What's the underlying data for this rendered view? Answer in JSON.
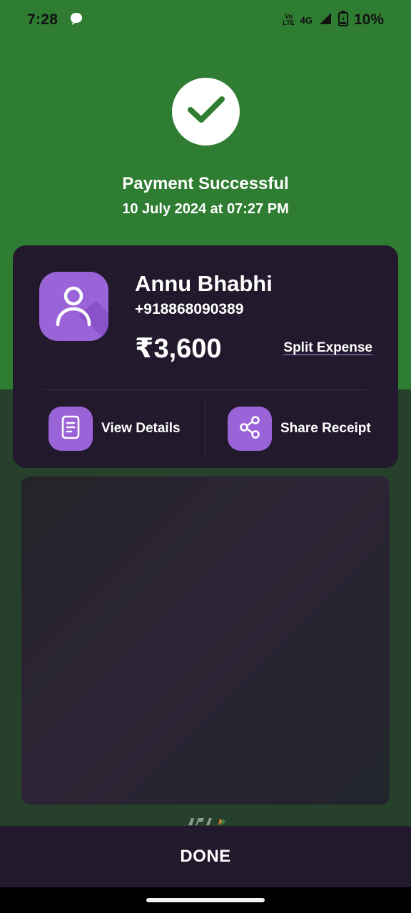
{
  "status_bar": {
    "time": "7:28",
    "volte_top": "Vo",
    "volte_bottom": "LTE",
    "network": "4G",
    "battery": "10%"
  },
  "header": {
    "title": "Payment Successful",
    "datetime": "10 July 2024 at 07:27 PM"
  },
  "payment": {
    "payee_name": "Annu Bhabhi",
    "payee_phone": "+918868090389",
    "amount": "₹3,600",
    "split_label": "Split Expense"
  },
  "actions": {
    "view_details": "View Details",
    "share_receipt": "Share Receipt"
  },
  "footer": {
    "done_label": "DONE"
  },
  "colors": {
    "success_green": "#2f7d32",
    "card_bg": "#221a2c",
    "accent_purple": "#9b63d8"
  },
  "icons": [
    "message-icon",
    "signal-icon",
    "battery-icon",
    "check-icon",
    "person-icon",
    "document-icon",
    "share-icon"
  ]
}
